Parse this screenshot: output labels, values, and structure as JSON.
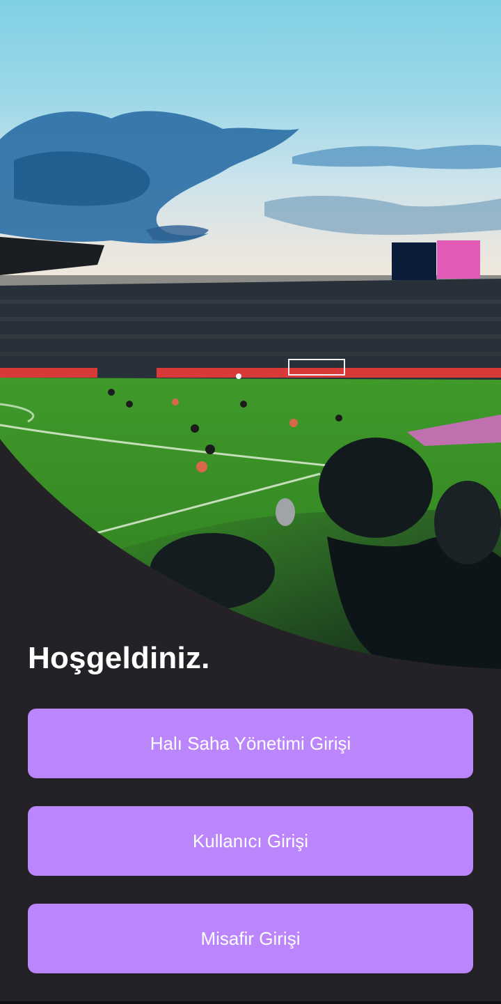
{
  "welcome": {
    "title": "Hoşgeldiniz."
  },
  "buttons": {
    "admin_login": "Halı Saha Yönetimi Girişi",
    "user_login": "Kullanıcı Girişi",
    "guest_login": "Misafir Girişi"
  },
  "colors": {
    "background": "#242226",
    "button": "#bb86fc",
    "button_text": "#ffffff"
  }
}
